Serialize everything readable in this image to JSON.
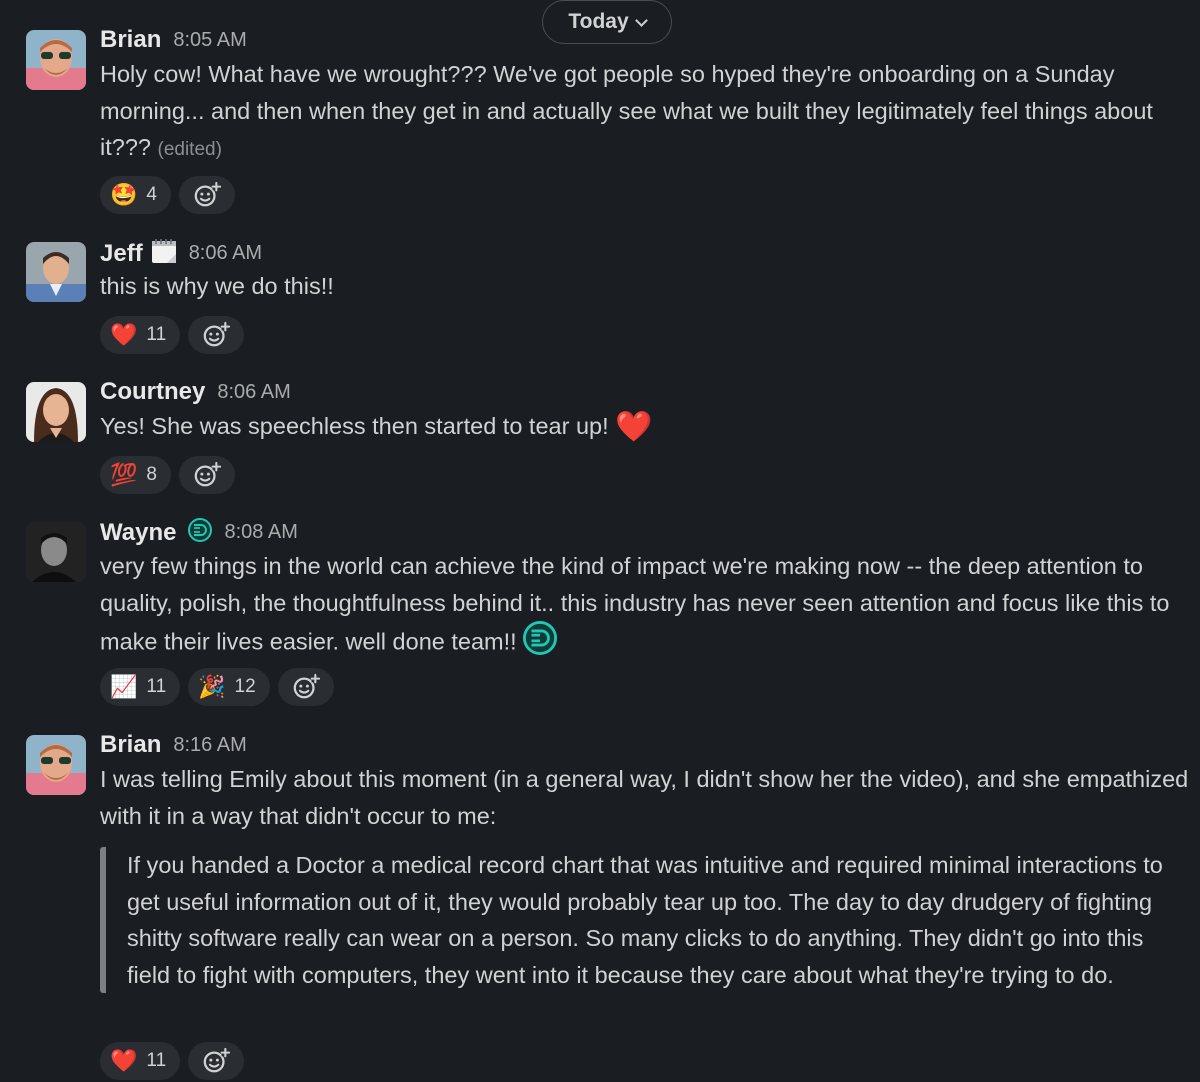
{
  "date_divider": {
    "label": "Today"
  },
  "messages": [
    {
      "author": "Brian",
      "time": "8:05 AM",
      "text": "Holy cow! What have we wrought??? We've got people so hyped they're onboarding on a Sunday morning... and then when they get in and actually see what we built they legitimately feel things about it???",
      "edited_label": "(edited)",
      "reactions": [
        {
          "emoji": "🤩",
          "count": "4"
        }
      ]
    },
    {
      "author": "Jeff",
      "time": "8:06 AM",
      "status_icon": "calendar-icon",
      "text": "this is why we do this!!",
      "reactions": [
        {
          "emoji": "❤️",
          "count": "11"
        }
      ]
    },
    {
      "author": "Courtney",
      "time": "8:06 AM",
      "text": "Yes! She was speechless then started to tear up!",
      "inline_emoji": "❤️",
      "reactions": [
        {
          "emoji": "💯",
          "count": "8"
        }
      ]
    },
    {
      "author": "Wayne",
      "time": "8:08 AM",
      "status_icon": "company-logo-icon",
      "text": "very few things in the world can achieve the kind of impact we're making now -- the deep attention to quality, polish, the thoughtfulness behind it.. this industry has never seen attention and focus like this to make their lives easier. well done team!!",
      "reactions": [
        {
          "emoji": "📈",
          "count": "11"
        },
        {
          "emoji": "🎉",
          "count": "12"
        }
      ]
    },
    {
      "author": "Brian",
      "time": "8:16 AM",
      "text": "I was telling Emily about this moment (in a general way, I didn't show her the video), and she empathized with it in a way that didn't occur to me:",
      "quote": "If you handed a Doctor a medical record chart that was intuitive and required minimal interactions to get useful information out of it, they would probably tear up too. The day to day drudgery of fighting shitty software really can wear on a person. So many clicks to do anything. They didn't go into this field to fight with computers, they went into it because they care about what they're trying to do.",
      "reactions": [
        {
          "emoji": "❤️",
          "count": "11"
        }
      ]
    }
  ]
}
